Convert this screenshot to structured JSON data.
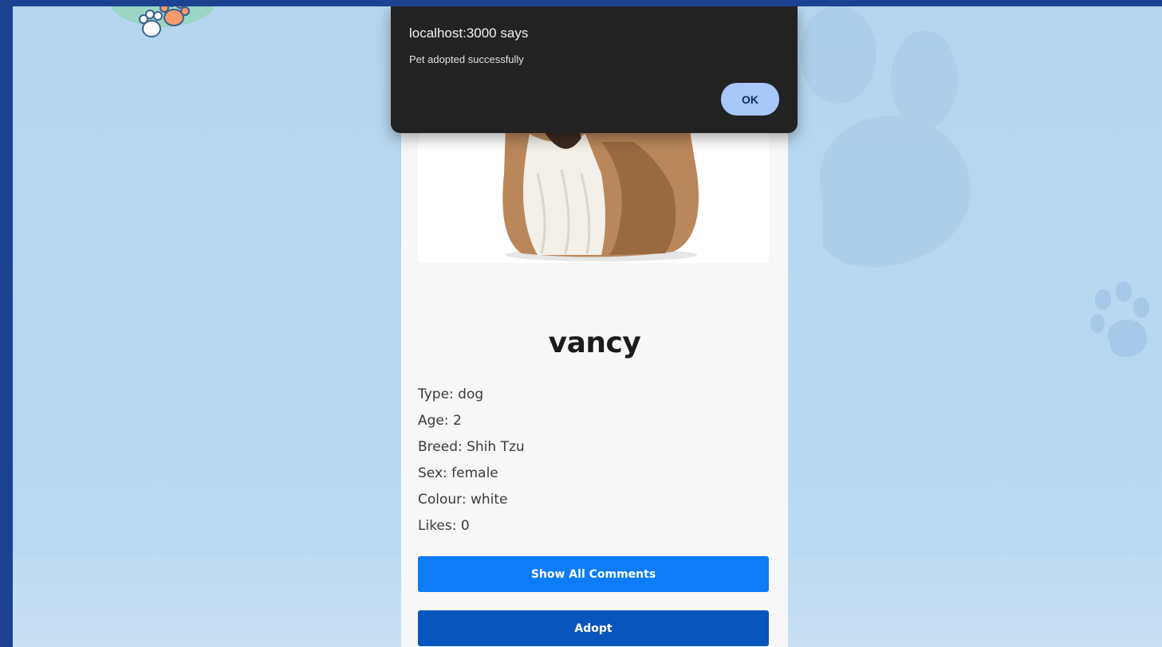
{
  "alert": {
    "title": "localhost:3000 says",
    "message": "Pet adopted successfully",
    "ok_label": "OK"
  },
  "pet": {
    "name": "vancy",
    "details": [
      "Type: dog",
      "Age: 2",
      "Breed: Shih Tzu",
      "Sex: female",
      "Colour: white",
      "Likes: 0"
    ],
    "show_comments_label": "Show All Comments",
    "adopt_label": "Adopt"
  },
  "colors": {
    "frame": "#1d4291",
    "page_bg": "#b6d6ef",
    "card_bg": "#f7f7f7",
    "comments_button": "#0d7cf6",
    "adopt_button": "#0656bd",
    "alert_bg": "#222222",
    "alert_ok_bg": "#a8c7fa"
  },
  "icons": {
    "logo": "paw-logo-icon",
    "background": "paw-print-icon"
  }
}
